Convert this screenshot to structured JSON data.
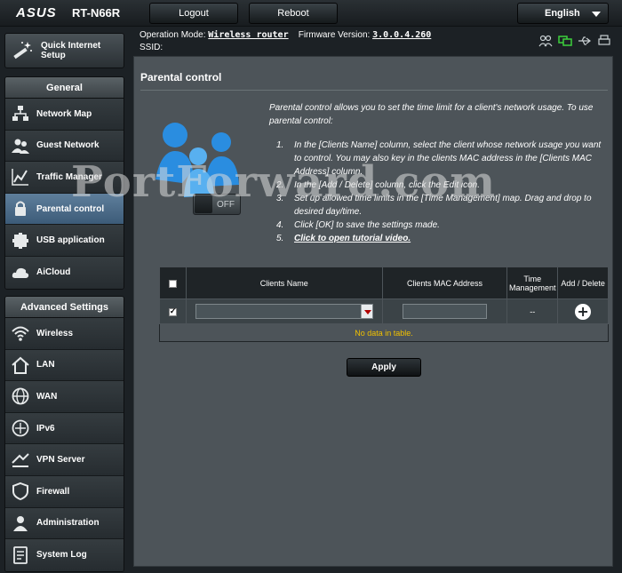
{
  "header": {
    "brand": "ASUS",
    "model": "RT-N66R",
    "logout_label": "Logout",
    "reboot_label": "Reboot",
    "language": "English"
  },
  "info": {
    "operation_mode_label": "Operation Mode:",
    "operation_mode_value": "Wireless router",
    "firmware_label": "Firmware Version:",
    "firmware_value": "3.0.0.4.260",
    "ssid_label": "SSID:",
    "status_icons": [
      "clients-icon",
      "network-status-icon",
      "usb-icon",
      "printer-icon"
    ]
  },
  "sidebar": {
    "qis_label": "Quick Internet Setup",
    "general_header": "General",
    "general_items": [
      {
        "label": "Network Map",
        "icon": "network-map-icon"
      },
      {
        "label": "Guest Network",
        "icon": "guest-network-icon"
      },
      {
        "label": "Traffic Manager",
        "icon": "traffic-manager-icon"
      },
      {
        "label": "Parental control",
        "icon": "parental-control-icon",
        "active": true
      },
      {
        "label": "USB application",
        "icon": "usb-application-icon"
      },
      {
        "label": "AiCloud",
        "icon": "aicloud-icon"
      }
    ],
    "advanced_header": "Advanced Settings",
    "advanced_items": [
      {
        "label": "Wireless",
        "icon": "wireless-icon"
      },
      {
        "label": "LAN",
        "icon": "lan-icon"
      },
      {
        "label": "WAN",
        "icon": "wan-icon"
      },
      {
        "label": "IPv6",
        "icon": "ipv6-icon"
      },
      {
        "label": "VPN Server",
        "icon": "vpn-server-icon"
      },
      {
        "label": "Firewall",
        "icon": "firewall-icon"
      },
      {
        "label": "Administration",
        "icon": "administration-icon"
      },
      {
        "label": "System Log",
        "icon": "system-log-icon"
      }
    ]
  },
  "main": {
    "title": "Parental control",
    "toggle_state": "OFF",
    "intro": "Parental control allows you to set the time limit for a client's network usage. To use parental control:",
    "steps": [
      {
        "num": "1.",
        "text": "In the [Clients Name] column, select the client whose network usage you want to control. You may also key in the clients MAC address in the [Clients MAC Address] column."
      },
      {
        "num": "2.",
        "text": "In the [Add / Delete] column, click the Edit icon."
      },
      {
        "num": "3.",
        "text": "Set up allowed time limits in the [Time Management] map. Drag and drop to desired day/time."
      },
      {
        "num": "4.",
        "text": "Click [OK] to save the settings made."
      },
      {
        "num": "5.",
        "text": "Click to open tutorial video.",
        "link": true
      }
    ],
    "table": {
      "headers": [
        "",
        "Clients Name",
        "Clients MAC Address",
        "Time Management",
        "Add / Delete"
      ],
      "time_management_value": "--",
      "empty_text": "No data in table."
    },
    "apply_label": "Apply"
  },
  "watermark": "PortForward.com"
}
